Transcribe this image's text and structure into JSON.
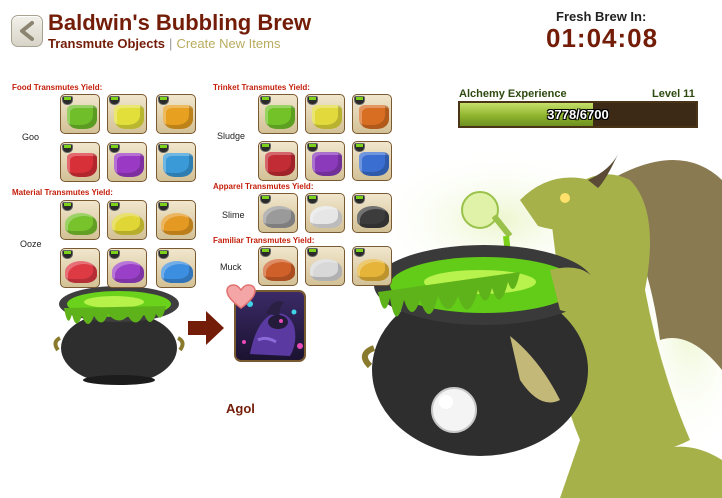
{
  "header": {
    "title": "Baldwin's Bubbling Brew",
    "active_tab": "Transmute Objects",
    "separator": "|",
    "link_tab": "Create New Items"
  },
  "timer": {
    "label": "Fresh Brew In:",
    "value": "01:04:08"
  },
  "experience": {
    "label": "Alchemy Experience",
    "level": "Level 11",
    "current": 3778,
    "max": 6700,
    "text": "3778/6700",
    "fill_fraction": 0.564
  },
  "sections": {
    "food": {
      "title": "Food Transmutes Yield:",
      "row_label": "Goo",
      "colors": [
        "#6fbe2a",
        "#e2df3a",
        "#e7a020",
        "#d83038",
        "#9a3ac4",
        "#3a9ad8"
      ]
    },
    "material": {
      "title": "Material Transmutes Yield:",
      "row_label": "Ooze",
      "colors": [
        "#78c22c",
        "#e0d636",
        "#e49a22",
        "#de3a44",
        "#9a40c8",
        "#3c8ee0"
      ]
    },
    "trinket": {
      "title": "Trinket Transmutes Yield:",
      "row_label": "Sludge",
      "colors": [
        "#72c228",
        "#e2da3c",
        "#d86e22",
        "#c22c34",
        "#8a3aba",
        "#3a6ed0"
      ]
    },
    "apparel": {
      "title": "Apparel Transmutes Yield:",
      "row_label": "Slime",
      "colors": [
        "#9a9a9a",
        "#e6e6e6",
        "#3c3c3c"
      ]
    },
    "familiar": {
      "title": "Familiar Transmutes Yield:",
      "row_label": "Muck",
      "colors": [
        "#d0602a",
        "#d8d8d8",
        "#e6b438"
      ]
    }
  },
  "recipe": {
    "result_name": "Agol"
  },
  "colors": {
    "brand": "#731d08",
    "section_title": "#c41e0a",
    "link": "#b9ac60",
    "brew_green": "#7cd21a",
    "dragon_green": "#a6b14a"
  }
}
